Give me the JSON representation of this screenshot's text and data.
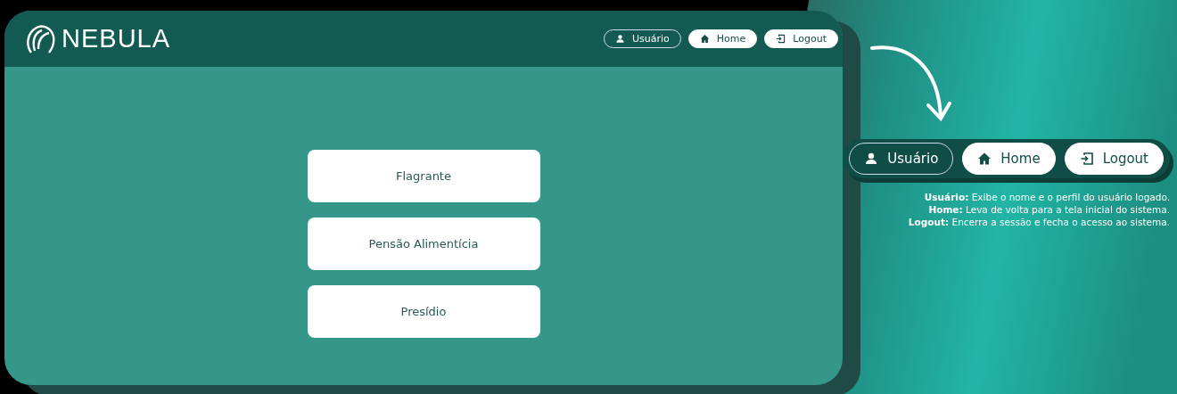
{
  "app": {
    "logo": "NEBULA",
    "nav_buttons": [
      {
        "kind": "outline",
        "label": "Usuário"
      },
      {
        "kind": "filled",
        "label": "Home"
      },
      {
        "kind": "filled",
        "label": "Logout"
      }
    ],
    "menu_options": [
      "Flagrante",
      "Pensão Alimentícia",
      "Presídio"
    ]
  },
  "callout": {
    "nav_buttons": [
      {
        "kind": "outline",
        "label": "Usuário"
      },
      {
        "kind": "filled",
        "label": "Home"
      },
      {
        "kind": "filled",
        "label": "Logout"
      }
    ],
    "descriptions": [
      "**Usuário:** Exibe o nome e o perfil do usuário logado.",
      "**Home:** Leva de volta para a tela inicial do sistema.",
      "**Logout:** Encerra a sessão e fecha o acesso ao sistema."
    ]
  }
}
